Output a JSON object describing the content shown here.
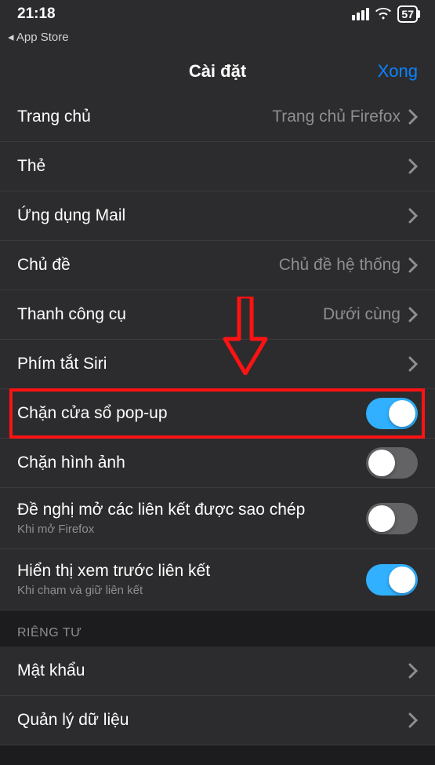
{
  "status": {
    "time": "21:18",
    "back_app": "◂ App Store",
    "battery": "57"
  },
  "header": {
    "title": "Cài đặt",
    "done": "Xong"
  },
  "rows": {
    "home": {
      "label": "Trang chủ",
      "value": "Trang chủ Firefox"
    },
    "tabs": {
      "label": "Thẻ"
    },
    "mail": {
      "label": "Ứng dụng Mail"
    },
    "theme": {
      "label": "Chủ đề",
      "value": "Chủ đề hệ thống"
    },
    "toolbar": {
      "label": "Thanh công cụ",
      "value": "Dưới cùng"
    },
    "siri": {
      "label": "Phím tắt Siri"
    },
    "popup": {
      "label": "Chặn cửa sổ pop-up"
    },
    "block_images": {
      "label": "Chặn hình ảnh"
    },
    "clipboard": {
      "label": "Đề nghị mở các liên kết được sao chép",
      "sub": "Khi mở Firefox"
    },
    "link_preview": {
      "label": "Hiển thị xem trước liên kết",
      "sub": "Khi chạm và giữ liên kết"
    },
    "passwords": {
      "label": "Mật khẩu"
    },
    "data_mgmt": {
      "label": "Quản lý dữ liệu"
    }
  },
  "sections": {
    "privacy": "RIÊNG TƯ"
  }
}
